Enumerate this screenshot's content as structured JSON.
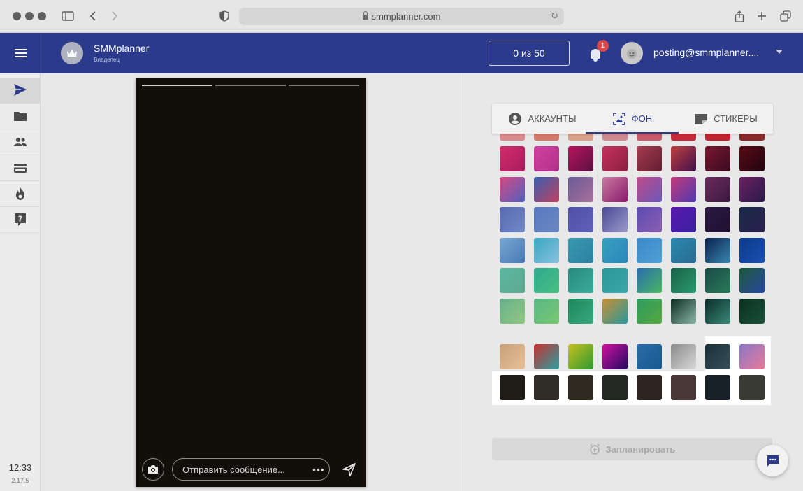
{
  "browser": {
    "url": "smmplanner.com"
  },
  "header": {
    "brand_name": "SMMplanner",
    "brand_role": "Владелец",
    "counter": "0 из 50",
    "notification_count": "1",
    "user_email": "posting@smmplanner...."
  },
  "sidebar": {
    "items": [
      {
        "icon": "send-icon",
        "active": true
      },
      {
        "icon": "folder-icon",
        "active": false
      },
      {
        "icon": "people-icon",
        "active": false
      },
      {
        "icon": "card-icon",
        "active": false
      },
      {
        "icon": "fire-icon",
        "active": false
      },
      {
        "icon": "help-icon",
        "active": false
      }
    ],
    "time": "12:33",
    "version": "2.17.5"
  },
  "story": {
    "progress_segments": 3,
    "message_placeholder": "Отправить сообщение...",
    "more_label": "•••"
  },
  "panel": {
    "tabs": [
      {
        "label": "АККАУНТЫ",
        "icon": "account-circle-icon",
        "active": false
      },
      {
        "label": "ФОН",
        "icon": "background-image-icon",
        "active": true
      },
      {
        "label": "СТИКЕРЫ",
        "icon": "sticker-icon",
        "active": false
      }
    ],
    "schedule_label": "Запланировать"
  },
  "colors": {
    "accent": "#2c3a8c",
    "story_bg": "#120f0b"
  },
  "swatches": {
    "partial_row": [
      "#d88a8c",
      "#d47a6a",
      "#d9a088",
      "#d28a92",
      "#c85a6a",
      "#c82a3a",
      "#c0242e",
      "#8a2a2a"
    ],
    "rows": [
      [
        [
          "#d22b6c",
          "#a81d5d"
        ],
        [
          "#d140a0",
          "#b0308a"
        ],
        [
          "#b8155e",
          "#5a1040"
        ],
        [
          "#c43060",
          "#8c2040"
        ],
        [
          "#a83a50",
          "#602030"
        ],
        [
          "#c04040",
          "#40104a"
        ],
        [
          "#7a1830",
          "#3a0a20"
        ],
        [
          "#5a0a14",
          "#200410"
        ]
      ],
      [
        [
          "#d84a80",
          "#5060c0"
        ],
        [
          "#3a60b0",
          "#c04060"
        ],
        [
          "#6a5a98",
          "#a8709a"
        ],
        [
          "#c87aa0",
          "#8a1a6a"
        ],
        [
          "#c04a8a",
          "#6a58b8"
        ],
        [
          "#c43a7a",
          "#503ab0"
        ],
        [
          "#6a2a5a",
          "#3a1a40"
        ],
        [
          "#6a2060",
          "#2a1a4a"
        ]
      ],
      [
        [
          "#5a6ab0",
          "#7088c8"
        ],
        [
          "#5878c0",
          "#6a88c0"
        ],
        [
          "#5050a8",
          "#6060b8"
        ],
        [
          "#4a4a98",
          "#9a9ac8"
        ],
        [
          "#5a4ab0",
          "#8a60b0"
        ],
        [
          "#5a18b0",
          "#3a20a0"
        ],
        [
          "#2a1840",
          "#201030"
        ],
        [
          "#1a2a48",
          "#2a2050"
        ]
      ],
      [
        [
          "#78a8d0",
          "#4a7ab8"
        ],
        [
          "#38a8c0",
          "#88c0e0"
        ],
        [
          "#3a9ab0",
          "#2a80a0"
        ],
        [
          "#38a0c0",
          "#2a88b8"
        ],
        [
          "#3a88c8",
          "#50a0d8"
        ],
        [
          "#2a8ab0",
          "#2a6a90"
        ],
        [
          "#08204a",
          "#3a88b0"
        ],
        [
          "#0a3a8a",
          "#1a50b0"
        ]
      ],
      [
        [
          "#5ab8a0",
          "#60a890"
        ],
        [
          "#30a890",
          "#48c080"
        ],
        [
          "#2a8a80",
          "#3aaa98"
        ],
        [
          "#2a9898",
          "#3aa8a8"
        ],
        [
          "#2a6ab0",
          "#48b860"
        ],
        [
          "#1a6048",
          "#2a9a70"
        ],
        [
          "#1a4a48",
          "#2a7a58"
        ],
        [
          "#1a5a38",
          "#2a48a0"
        ]
      ],
      [
        [
          "#6ab090",
          "#90c880"
        ],
        [
          "#58b888",
          "#7ac870"
        ],
        [
          "#1a8858",
          "#3aa880"
        ],
        [
          "#c89030",
          "#2a98a0"
        ],
        [
          "#2a9a60",
          "#58a840"
        ],
        [
          "#0a2a20",
          "#8ab8a8"
        ],
        [
          "#0a2a28",
          "#3a8a78"
        ],
        [
          "#0a3020",
          "#1a5038"
        ]
      ],
      [
        [
          "#c8a078",
          "#e8c098"
        ],
        [
          "#c83030",
          "#2aa0a0"
        ],
        [
          "#c8c020",
          "#2a9a30"
        ],
        [
          "#d010a0",
          "#200a60"
        ],
        [
          "#2a6aa8",
          "#1a5a90"
        ],
        [
          "#8a8a8a",
          "#d8d8d8"
        ],
        [
          "#1a3038",
          "#3a5058"
        ],
        [
          "#8a78c8",
          "#e87a98"
        ]
      ]
    ],
    "dark_row": [
      "#201d18",
      "#302c28",
      "#2e2a20",
      "#232823",
      "#2e2420",
      "#4a3838",
      "#18202a",
      "#3a3a34"
    ]
  }
}
